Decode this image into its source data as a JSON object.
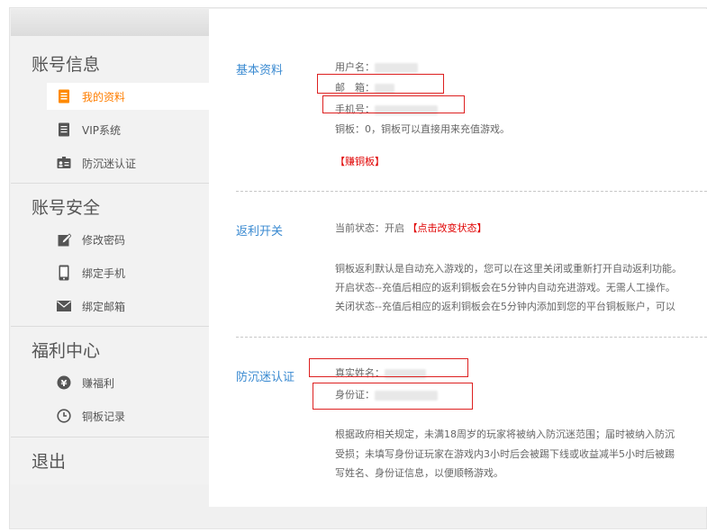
{
  "sidebar": {
    "groups": [
      {
        "title": "账号信息",
        "items": [
          {
            "label": "我的资料",
            "icon": "document-icon",
            "active": true
          },
          {
            "label": "VIP系统",
            "icon": "list-icon"
          },
          {
            "label": "防沉迷认证",
            "icon": "id-card-icon"
          }
        ]
      },
      {
        "title": "账号安全",
        "items": [
          {
            "label": "修改密码",
            "icon": "edit-icon"
          },
          {
            "label": "绑定手机",
            "icon": "phone-icon"
          },
          {
            "label": "绑定邮箱",
            "icon": "mail-icon"
          }
        ]
      },
      {
        "title": "福利中心",
        "items": [
          {
            "label": "赚福利",
            "icon": "yen-icon"
          },
          {
            "label": "铜板记录",
            "icon": "clock-icon"
          }
        ]
      },
      {
        "title": "退出",
        "items": []
      }
    ],
    "active_color": "#ff7e00"
  },
  "basic": {
    "label": "基本资料",
    "username_label": "用户名：",
    "email_label": "邮　箱：",
    "phone_label": "手机号：",
    "coins_text": "铜板：0，铜板可以直接用来充值游戏。",
    "earn_link": "【赚铜板】"
  },
  "rebate": {
    "label": "返利开关",
    "status_text": "当前状态：开启",
    "change_link": "【点击改变状态】",
    "desc1": "铜板返利默认是自动充入游戏的，您可以在这里关闭或重新打开自动返利功能。",
    "desc2": "开启状态--充值后相应的返利铜板会在5分钟内自动充进游戏。无需人工操作。",
    "desc3": "关闭状态--充值后相应的返利铜板会在5分钟内添加到您的平台铜板账户，可以"
  },
  "anti_addiction": {
    "label": "防沉迷认证",
    "realname_label": "真实姓名：",
    "idcard_label": "身份证：",
    "desc1": "根据政府相关规定，未满18周岁的玩家将被纳入防沉迷范围；届时被纳入防沉",
    "desc2": "受损；未填写身份证玩家在游戏内3小时后会被踢下线或收益减半5小时后被踢",
    "desc3": "写姓名、身份证信息，以便顺畅游戏。"
  },
  "colors": {
    "link_blue": "#3a8ad1",
    "accent_red": "#e00000",
    "highlight_box": "#dd2020"
  }
}
